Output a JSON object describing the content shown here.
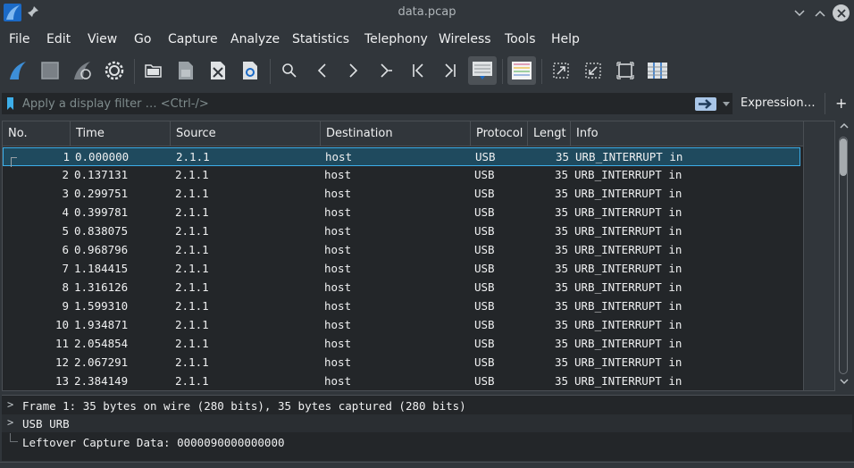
{
  "window": {
    "title": "data.pcap"
  },
  "menu": [
    "File",
    "Edit",
    "View",
    "Go",
    "Capture",
    "Analyze",
    "Statistics",
    "Telephony",
    "Wireless",
    "Tools",
    "Help"
  ],
  "toolbar": {
    "icons": [
      "shark-fin-start-icon",
      "stop-square-icon",
      "restart-fin-icon",
      "gear-options-icon",
      "open-folder-icon",
      "save-file-icon",
      "close-file-icon",
      "reload-file-icon",
      "search-icon",
      "back-arrow-icon",
      "forward-arrow-icon",
      "go-to-packet-icon",
      "first-packet-icon",
      "last-packet-icon",
      "auto-scroll-icon",
      "colorize-icon",
      "zoom-in-icon",
      "zoom-out-icon",
      "normal-size-icon",
      "resize-columns-icon"
    ]
  },
  "filter": {
    "placeholder": "Apply a display filter … <Ctrl-/>",
    "expression_label": "Expression…",
    "plus_label": "+"
  },
  "packet_list": {
    "columns": [
      "No.",
      "Time",
      "Source",
      "Destination",
      "Protocol",
      "Lengt",
      "Info"
    ],
    "rows": [
      {
        "no": "1",
        "time": "0.000000",
        "src": "2.1.1",
        "dst": "host",
        "proto": "USB",
        "len": "35",
        "info": "URB_INTERRUPT in"
      },
      {
        "no": "2",
        "time": "0.137131",
        "src": "2.1.1",
        "dst": "host",
        "proto": "USB",
        "len": "35",
        "info": "URB_INTERRUPT in"
      },
      {
        "no": "3",
        "time": "0.299751",
        "src": "2.1.1",
        "dst": "host",
        "proto": "USB",
        "len": "35",
        "info": "URB_INTERRUPT in"
      },
      {
        "no": "4",
        "time": "0.399781",
        "src": "2.1.1",
        "dst": "host",
        "proto": "USB",
        "len": "35",
        "info": "URB_INTERRUPT in"
      },
      {
        "no": "5",
        "time": "0.838075",
        "src": "2.1.1",
        "dst": "host",
        "proto": "USB",
        "len": "35",
        "info": "URB_INTERRUPT in"
      },
      {
        "no": "6",
        "time": "0.968796",
        "src": "2.1.1",
        "dst": "host",
        "proto": "USB",
        "len": "35",
        "info": "URB_INTERRUPT in"
      },
      {
        "no": "7",
        "time": "1.184415",
        "src": "2.1.1",
        "dst": "host",
        "proto": "USB",
        "len": "35",
        "info": "URB_INTERRUPT in"
      },
      {
        "no": "8",
        "time": "1.316126",
        "src": "2.1.1",
        "dst": "host",
        "proto": "USB",
        "len": "35",
        "info": "URB_INTERRUPT in"
      },
      {
        "no": "9",
        "time": "1.599310",
        "src": "2.1.1",
        "dst": "host",
        "proto": "USB",
        "len": "35",
        "info": "URB_INTERRUPT in"
      },
      {
        "no": "10",
        "time": "1.934871",
        "src": "2.1.1",
        "dst": "host",
        "proto": "USB",
        "len": "35",
        "info": "URB_INTERRUPT in"
      },
      {
        "no": "11",
        "time": "2.054854",
        "src": "2.1.1",
        "dst": "host",
        "proto": "USB",
        "len": "35",
        "info": "URB_INTERRUPT in"
      },
      {
        "no": "12",
        "time": "2.067291",
        "src": "2.1.1",
        "dst": "host",
        "proto": "USB",
        "len": "35",
        "info": "URB_INTERRUPT in"
      },
      {
        "no": "13",
        "time": "2.384149",
        "src": "2.1.1",
        "dst": "host",
        "proto": "USB",
        "len": "35",
        "info": "URB_INTERRUPT in"
      }
    ]
  },
  "details": {
    "items": [
      {
        "text": "Frame 1: 35 bytes on wire (280 bits), 35 bytes captured (280 bits)",
        "expandable": true
      },
      {
        "text": "USB URB",
        "expandable": true
      },
      {
        "text": "Leftover Capture Data: 0000090000000000",
        "expandable": false
      }
    ]
  },
  "colors": {
    "accent": "#3daee9",
    "selection": "#1f4a5e",
    "background": "#31363b",
    "pane": "#232629"
  }
}
